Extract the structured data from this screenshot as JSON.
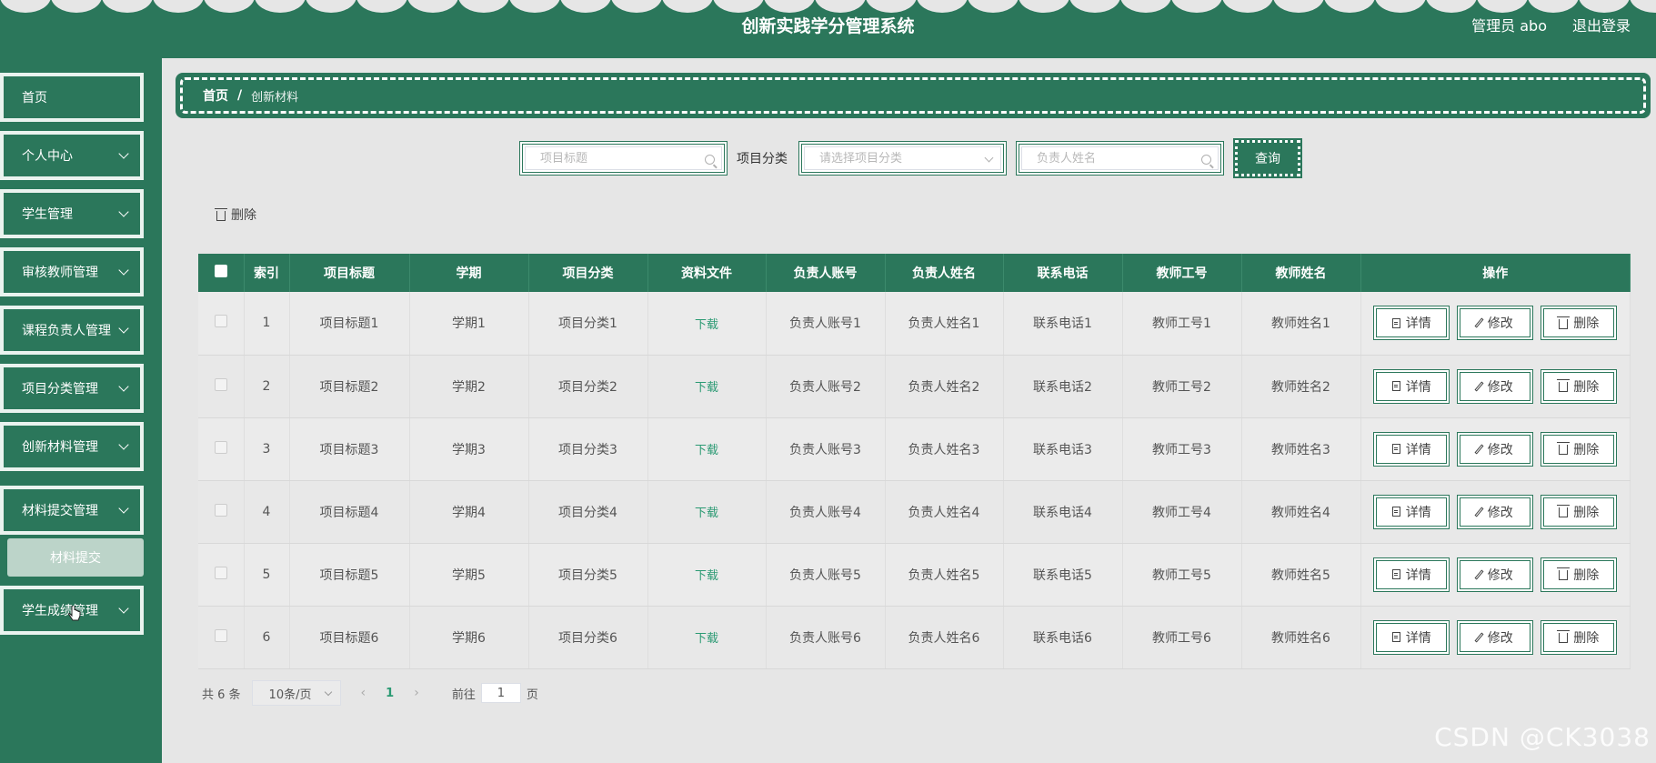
{
  "header": {
    "title": "创新实践学分管理系统",
    "user": "管理员 abo",
    "logout": "退出登录"
  },
  "sidebar": {
    "items": [
      {
        "label": "首页"
      },
      {
        "label": "个人中心"
      },
      {
        "label": "学生管理"
      },
      {
        "label": "审核教师管理"
      },
      {
        "label": "课程负责人管理"
      },
      {
        "label": "项目分类管理"
      },
      {
        "label": "创新材料管理"
      },
      {
        "label": "材料提交管理"
      },
      {
        "label": "学生成绩管理"
      }
    ],
    "submenu": {
      "label": "材料提交"
    }
  },
  "breadcrumb": {
    "home": "首页",
    "separator": "/",
    "current": "创新材料"
  },
  "search": {
    "title_placeholder": "项目标题",
    "category_label": "项目分类",
    "category_placeholder": "请选择项目分类",
    "owner_placeholder": "负责人姓名",
    "query_label": "查询"
  },
  "toolbar": {
    "delete_label": "删除"
  },
  "table": {
    "columns": [
      "索引",
      "项目标题",
      "学期",
      "项目分类",
      "资料文件",
      "负责人账号",
      "负责人姓名",
      "联系电话",
      "教师工号",
      "教师姓名",
      "操作"
    ],
    "rows": [
      {
        "index": "1",
        "title": "项目标题1",
        "term": "学期1",
        "category": "项目分类1",
        "file": "下载",
        "account": "负责人账号1",
        "name": "负责人姓名1",
        "phone": "联系电话1",
        "teacher_id": "教师工号1",
        "teacher_name": "教师姓名1"
      },
      {
        "index": "2",
        "title": "项目标题2",
        "term": "学期2",
        "category": "项目分类2",
        "file": "下载",
        "account": "负责人账号2",
        "name": "负责人姓名2",
        "phone": "联系电话2",
        "teacher_id": "教师工号2",
        "teacher_name": "教师姓名2"
      },
      {
        "index": "3",
        "title": "项目标题3",
        "term": "学期3",
        "category": "项目分类3",
        "file": "下载",
        "account": "负责人账号3",
        "name": "负责人姓名3",
        "phone": "联系电话3",
        "teacher_id": "教师工号3",
        "teacher_name": "教师姓名3"
      },
      {
        "index": "4",
        "title": "项目标题4",
        "term": "学期4",
        "category": "项目分类4",
        "file": "下载",
        "account": "负责人账号4",
        "name": "负责人姓名4",
        "phone": "联系电话4",
        "teacher_id": "教师工号4",
        "teacher_name": "教师姓名4"
      },
      {
        "index": "5",
        "title": "项目标题5",
        "term": "学期5",
        "category": "项目分类5",
        "file": "下载",
        "account": "负责人账号5",
        "name": "负责人姓名5",
        "phone": "联系电话5",
        "teacher_id": "教师工号5",
        "teacher_name": "教师姓名5"
      },
      {
        "index": "6",
        "title": "项目标题6",
        "term": "学期6",
        "category": "项目分类6",
        "file": "下载",
        "account": "负责人账号6",
        "name": "负责人姓名6",
        "phone": "联系电话6",
        "teacher_id": "教师工号6",
        "teacher_name": "教师姓名6"
      }
    ],
    "actions": {
      "detail": "详情",
      "edit": "修改",
      "delete": "删除"
    }
  },
  "pagination": {
    "total": "共 6 条",
    "page_size": "10条/页",
    "prev": "‹",
    "current": "1",
    "next": "›",
    "goto_prefix": "前往",
    "goto_value": "1",
    "goto_suffix": "页"
  },
  "watermark": "CSDN @CK3038",
  "colors": {
    "primary": "#2b775b",
    "background": "#e6e6e6",
    "link": "#2b9a73"
  }
}
